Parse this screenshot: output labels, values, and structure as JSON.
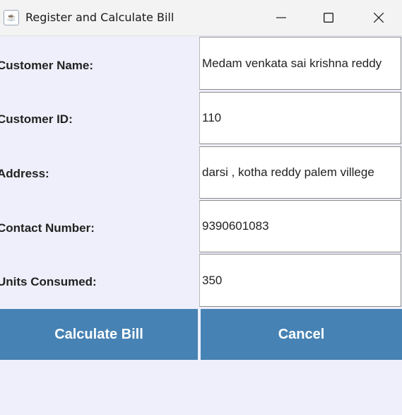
{
  "window": {
    "title": "Register and Calculate Bill",
    "icon": "java-icon",
    "controls": [
      "minimize-icon",
      "maximize-icon",
      "close-icon"
    ]
  },
  "form": {
    "rows": [
      {
        "label": "Customer Name:",
        "value": "Medam venkata sai krishna reddy"
      },
      {
        "label": "Customer ID:",
        "value": "110"
      },
      {
        "label": "Address:",
        "value": "darsi , kotha reddy palem villege"
      },
      {
        "label": "Contact Number:",
        "value": "9390601083"
      },
      {
        "label": "Units Consumed:",
        "value": "350"
      }
    ]
  },
  "buttons": {
    "calculate_label": "Calculate Bill",
    "cancel_label": "Cancel"
  },
  "colors": {
    "background": "#efeffb",
    "button": "#4682b4",
    "button_text": "#ffffff"
  }
}
